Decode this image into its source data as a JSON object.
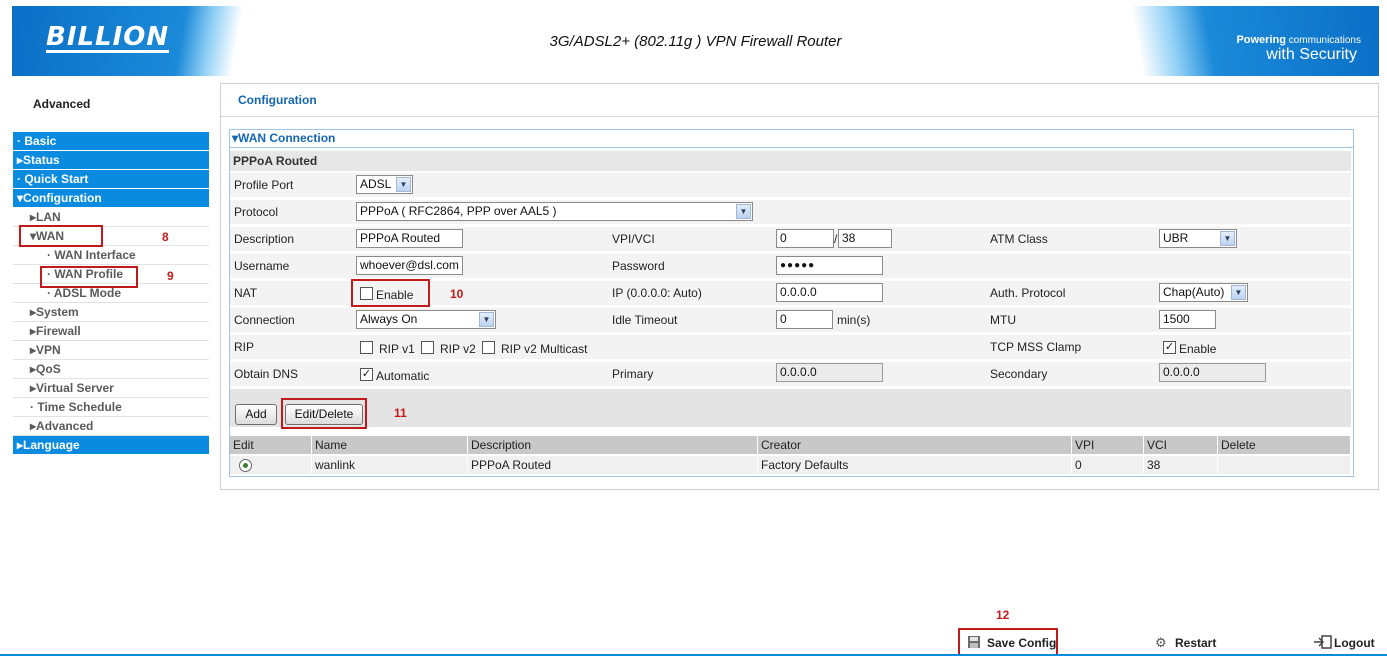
{
  "header": {
    "logo": "BILLION",
    "title": "3G/ADSL2+ (802.11g ) VPN Firewall Router",
    "tagline_top": "Powering",
    "tagline_small": "communications",
    "tagline_bottom": "with Security"
  },
  "sidebar": {
    "title": "Advanced",
    "items": [
      {
        "label": "· Basic"
      },
      {
        "label": "▸Status"
      },
      {
        "label": "· Quick Start"
      },
      {
        "label": "▾Configuration"
      },
      {
        "label": "▸LAN"
      },
      {
        "label": "▾WAN"
      },
      {
        "label": "· WAN Interface"
      },
      {
        "label": "· WAN Profile"
      },
      {
        "label": "· ADSL Mode"
      },
      {
        "label": "▸System"
      },
      {
        "label": "▸Firewall"
      },
      {
        "label": "▸VPN"
      },
      {
        "label": "▸QoS"
      },
      {
        "label": "▸Virtual Server"
      },
      {
        "label": "· Time Schedule"
      },
      {
        "label": "▸Advanced"
      },
      {
        "label": "▸Language"
      }
    ]
  },
  "main": {
    "title": "Configuration",
    "wan_header": "▾WAN Connection",
    "section": "PPPoA Routed",
    "profile_port": {
      "label": "Profile Port",
      "value": "ADSL"
    },
    "protocol": {
      "label": "Protocol",
      "value": "PPPoA ( RFC2864, PPP over AAL5 )"
    },
    "description": {
      "label": "Description",
      "value": "PPPoA Routed"
    },
    "vpivci": {
      "label": "VPI/VCI",
      "vpi": "0",
      "sep": "/",
      "vci": "38"
    },
    "atm_class": {
      "label": "ATM Class",
      "value": "UBR"
    },
    "username": {
      "label": "Username",
      "value": "whoever@dsl.com"
    },
    "password": {
      "label": "Password",
      "value": "●●●●●"
    },
    "nat": {
      "label": "NAT",
      "option": "Enable"
    },
    "ip": {
      "label": "IP (0.0.0.0: Auto)",
      "value": "0.0.0.0"
    },
    "auth": {
      "label": "Auth. Protocol",
      "value": "Chap(Auto)"
    },
    "connection": {
      "label": "Connection",
      "value": "Always On"
    },
    "idle": {
      "label": "Idle Timeout",
      "value": "0",
      "unit": "min(s)"
    },
    "mtu": {
      "label": "MTU",
      "value": "1500"
    },
    "rip": {
      "label": "RIP",
      "v1": "RIP v1",
      "v2": "RIP v2",
      "v2m": "RIP v2 Multicast"
    },
    "tcp_mss": {
      "label": "TCP MSS Clamp",
      "option": "Enable"
    },
    "dns": {
      "label": "Obtain DNS",
      "option": "Automatic",
      "primary_label": "Primary",
      "primary": "0.0.0.0",
      "secondary_label": "Secondary",
      "secondary": "0.0.0.0"
    },
    "buttons": {
      "add": "Add",
      "edit_delete": "Edit/Delete"
    },
    "table": {
      "headers": [
        "Edit",
        "Name",
        "Description",
        "Creator",
        "VPI",
        "VCI",
        "Delete"
      ],
      "rows": [
        {
          "name": "wanlink",
          "description": "PPPoA Routed",
          "creator": "Factory Defaults",
          "vpi": "0",
          "vci": "38",
          "delete": ""
        }
      ]
    }
  },
  "annotations": {
    "n8": "8",
    "n9": "9",
    "n10": "10",
    "n11": "11",
    "n12": "12"
  },
  "footer": {
    "save": "Save Config",
    "restart": "Restart",
    "logout": "Logout"
  }
}
